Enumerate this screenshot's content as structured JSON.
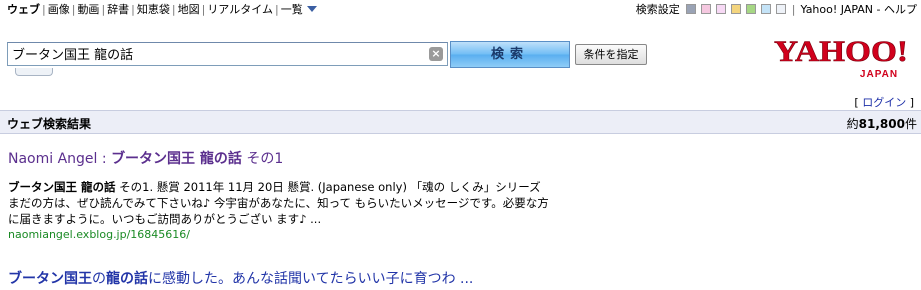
{
  "topnav": {
    "tabs": [
      {
        "label": "ウェブ",
        "active": true
      },
      {
        "label": "画像"
      },
      {
        "label": "動画"
      },
      {
        "label": "辞書"
      },
      {
        "label": "知恵袋"
      },
      {
        "label": "地図"
      },
      {
        "label": "リアルタイム"
      },
      {
        "label": "一覧"
      }
    ],
    "settings_label": "検索設定",
    "theme_colors": [
      "#9aa3b5",
      "#f5c8e0",
      "#f7d9f5",
      "#f4d57e",
      "#a6d784",
      "#c4e3f7",
      "#eef2f8"
    ],
    "brand_links": "Yahoo! JAPAN - ヘルプ"
  },
  "search": {
    "query": "ブータン国王 龍の話",
    "button_label": "検索",
    "conditions_label": "条件を指定"
  },
  "logo": {
    "text": "YAHOO!",
    "sub": "JAPAN",
    "color": "#d1001c"
  },
  "login": {
    "bracket_open": "[",
    "label": "ログイン",
    "bracket_close": "]"
  },
  "results_header": {
    "title": "ウェブ検索結果",
    "count_prefix": "約",
    "count": "81,800",
    "count_suffix": "件"
  },
  "results": [
    {
      "title_a": "Naomi Angel : ",
      "title_b": "ブータン国王 龍の話",
      "title_c": " その1",
      "snippet_hl": "ブータン国王 龍の話",
      "snippet_1": " その1. 懸賞 2011年 11月 20日 懸賞. (Japanese only) 「魂の しくみ」シリーズ",
      "snippet_2": "まだの方は、ぜひ読んでみて下さいね♪ 今宇宙があなたに、知って もらいたいメッセージです。必要な方",
      "snippet_3": "に届きますように。いつもご訪問ありがとうござい ます♪ ...",
      "url": "naomiangel.exblog.jp/16845616/"
    },
    {
      "title_a": "ブータン国王",
      "title_b": "の",
      "title_c": "龍の話",
      "title_d": "に感動した。あんな話聞いてたらいい子に育つわ ..."
    }
  ]
}
